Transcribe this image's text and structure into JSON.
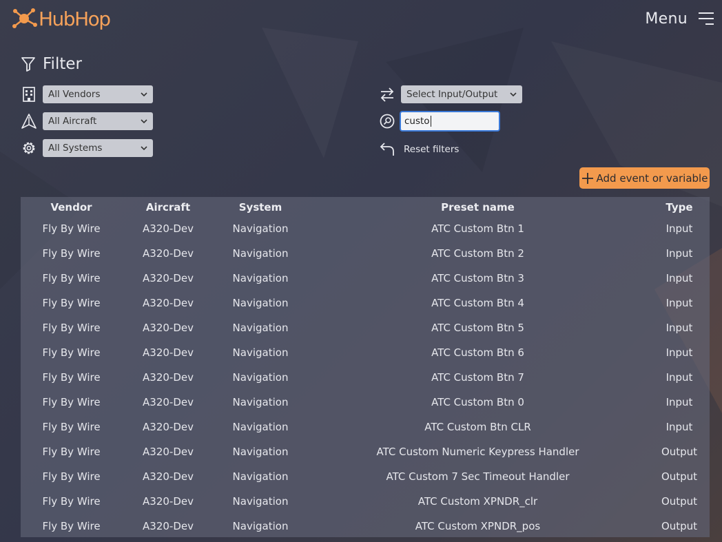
{
  "app": {
    "name": "HubHop"
  },
  "header": {
    "menu_label": "Menu"
  },
  "filter": {
    "title": "Filter",
    "vendor_select": "All Vendors",
    "aircraft_select": "All Aircraft",
    "system_select": "All Systems",
    "io_select": "Select Input/Output",
    "search_value": "custo",
    "reset_label": "Reset filters"
  },
  "actions": {
    "add_label": "Add event or variable"
  },
  "table": {
    "columns": [
      "Vendor",
      "Aircraft",
      "System",
      "Preset name",
      "Type"
    ],
    "rows": [
      [
        "Fly By Wire",
        "A320-Dev",
        "Navigation",
        "ATC Custom Btn 1",
        "Input"
      ],
      [
        "Fly By Wire",
        "A320-Dev",
        "Navigation",
        "ATC Custom Btn 2",
        "Input"
      ],
      [
        "Fly By Wire",
        "A320-Dev",
        "Navigation",
        "ATC Custom Btn 3",
        "Input"
      ],
      [
        "Fly By Wire",
        "A320-Dev",
        "Navigation",
        "ATC Custom Btn 4",
        "Input"
      ],
      [
        "Fly By Wire",
        "A320-Dev",
        "Navigation",
        "ATC Custom Btn 5",
        "Input"
      ],
      [
        "Fly By Wire",
        "A320-Dev",
        "Navigation",
        "ATC Custom Btn 6",
        "Input"
      ],
      [
        "Fly By Wire",
        "A320-Dev",
        "Navigation",
        "ATC Custom Btn 7",
        "Input"
      ],
      [
        "Fly By Wire",
        "A320-Dev",
        "Navigation",
        "ATC Custom Btn 0",
        "Input"
      ],
      [
        "Fly By Wire",
        "A320-Dev",
        "Navigation",
        "ATC Custom Btn CLR",
        "Input"
      ],
      [
        "Fly By Wire",
        "A320-Dev",
        "Navigation",
        "ATC Custom Numeric Keypress Handler",
        "Output"
      ],
      [
        "Fly By Wire",
        "A320-Dev",
        "Navigation",
        "ATC Custom 7 Sec Timeout Handler",
        "Output"
      ],
      [
        "Fly By Wire",
        "A320-Dev",
        "Navigation",
        "ATC Custom XPNDR_clr",
        "Output"
      ],
      [
        "Fly By Wire",
        "A320-Dev",
        "Navigation",
        "ATC Custom XPNDR_pos",
        "Output"
      ]
    ]
  },
  "colors": {
    "accent": "#f39a4d",
    "focus": "#3a79d8"
  },
  "icons": [
    "hubhop-logo-icon",
    "menu-icon",
    "filter-icon",
    "building-icon",
    "aircraft-icon",
    "gear-icon",
    "swap-icon",
    "search-icon",
    "undo-icon",
    "plus-icon",
    "chevron-down-icon"
  ]
}
